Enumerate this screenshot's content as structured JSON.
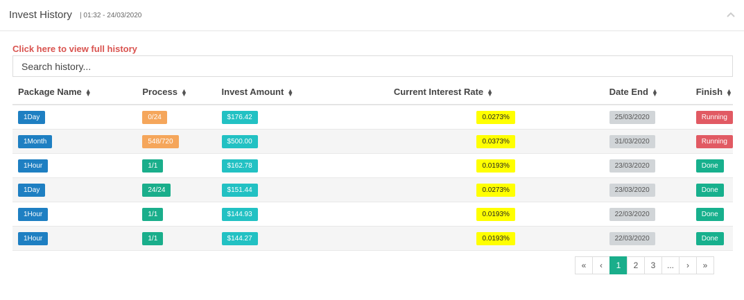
{
  "header": {
    "title": "Invest History",
    "subtitle": "| 01:32 - 24/03/2020"
  },
  "link": {
    "label": "Click here to view full history"
  },
  "search": {
    "placeholder": "Search history..."
  },
  "table": {
    "columns": [
      "Package Name",
      "Process",
      "Invest Amount",
      "Current Interest Rate",
      "Date End",
      "Finish"
    ],
    "rows": [
      {
        "package": "1Day",
        "process": "0/24",
        "amount": "$176.42",
        "rate": "0.0273%",
        "date_end": "25/03/2020",
        "finish": "Running"
      },
      {
        "package": "1Month",
        "process": "548/720",
        "amount": "$500.00",
        "rate": "0.0373%",
        "date_end": "31/03/2020",
        "finish": "Running"
      },
      {
        "package": "1Hour",
        "process": "1/1",
        "amount": "$162.78",
        "rate": "0.0193%",
        "date_end": "23/03/2020",
        "finish": "Done"
      },
      {
        "package": "1Day",
        "process": "24/24",
        "amount": "$151.44",
        "rate": "0.0273%",
        "date_end": "23/03/2020",
        "finish": "Done"
      },
      {
        "package": "1Hour",
        "process": "1/1",
        "amount": "$144.93",
        "rate": "0.0193%",
        "date_end": "22/03/2020",
        "finish": "Done"
      },
      {
        "package": "1Hour",
        "process": "1/1",
        "amount": "$144.27",
        "rate": "0.0193%",
        "date_end": "22/03/2020",
        "finish": "Done"
      }
    ]
  },
  "pagination": {
    "first": "«",
    "prev": "‹",
    "pages": [
      "1",
      "2",
      "3"
    ],
    "ellipsis": "...",
    "next": "›",
    "last": "»",
    "active": "1"
  },
  "colors": {
    "running": "#e15a63",
    "done": "#17b08d",
    "package": "#1e7fc2",
    "amount": "#22c1c3",
    "rate": "#ffff00",
    "link": "#d9534f"
  }
}
